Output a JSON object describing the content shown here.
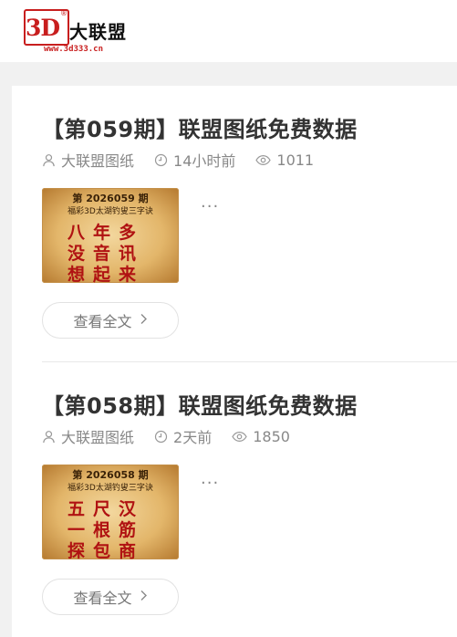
{
  "logo": {
    "mark": "3D",
    "reg": "®",
    "name": "大联盟",
    "url": "www.3d333.cn"
  },
  "posts": [
    {
      "title": "【第059期】联盟图纸免费数据",
      "author": "大联盟图纸",
      "time": "14小时前",
      "views": "1011",
      "thumb_issue": "第 2026059 期",
      "thumb_sub": "福彩3D太湖钓叟三字诀",
      "thumb_lines": [
        "八年多",
        "没音讯",
        "想起来"
      ],
      "excerpt": "···",
      "read_more": "查看全文"
    },
    {
      "title": "【第058期】联盟图纸免费数据",
      "author": "大联盟图纸",
      "time": "2天前",
      "views": "1850",
      "thumb_issue": "第 2026058 期",
      "thumb_sub": "福彩3D太湖钓叟三字诀",
      "thumb_lines": [
        "五尺汉",
        "一根筋",
        "探包商"
      ],
      "excerpt": "···",
      "read_more": "查看全文"
    }
  ],
  "colors": {
    "brand_red": "#c81e1e",
    "page_bg": "#f1f1f1",
    "verse_red": "#b01212"
  },
  "icons": {
    "author": "user-icon",
    "time": "clock-icon",
    "views": "eye-icon",
    "read_more": "chevron-right-icon"
  }
}
